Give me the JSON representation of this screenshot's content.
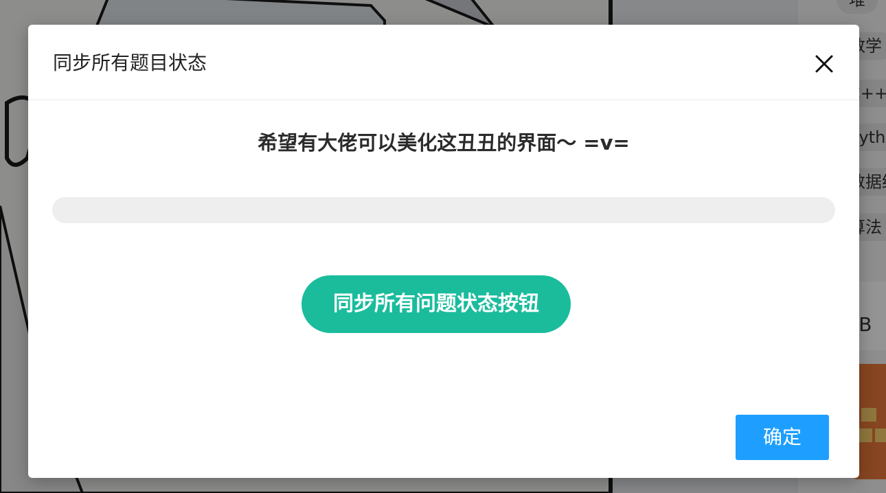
{
  "background": {
    "tags": [
      "堆",
      "数学",
      "C++",
      "Python",
      "数据结构",
      "算法（值"
    ],
    "side_text": "etB"
  },
  "modal": {
    "title": "同步所有题目状态",
    "close_icon": "close-icon",
    "subtitle": "希望有大佬可以美化这丑丑的界面～ =v=",
    "progress": 0,
    "sync_button_label": "同步所有问题状态按钮",
    "confirm_button_label": "确定"
  },
  "colors": {
    "accent_green": "#1abc9c",
    "confirm_blue": "#1e9fff",
    "progress_track": "#eeeeee"
  }
}
